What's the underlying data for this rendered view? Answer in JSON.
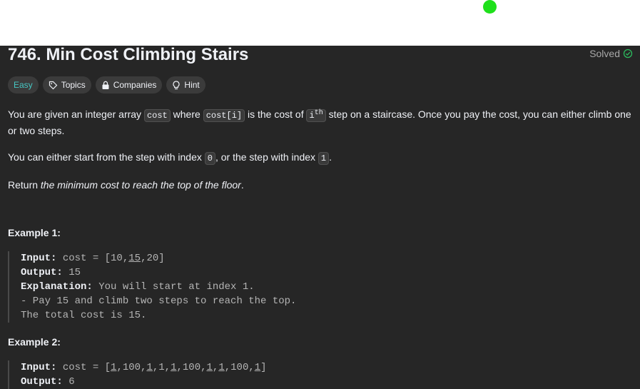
{
  "problem": {
    "title": "746. Min Cost Climbing Stairs",
    "solved_label": "Solved"
  },
  "tags": {
    "difficulty": "Easy",
    "topics": "Topics",
    "companies": "Companies",
    "hint": "Hint"
  },
  "description": {
    "p1_a": "You are given an integer array ",
    "p1_code1": "cost",
    "p1_b": " where ",
    "p1_code2": "cost[i]",
    "p1_c": " is the cost of ",
    "p1_code3": "i",
    "p1_sup": "th",
    "p1_d": " step on a staircase. Once you pay the cost, you can either climb one or two steps.",
    "p2_a": "You can either start from the step with index ",
    "p2_code1": "0",
    "p2_b": ", or the step with index ",
    "p2_code2": "1",
    "p2_c": ".",
    "p3_a": "Return ",
    "p3_em": "the minimum cost to reach the top of the floor",
    "p3_b": "."
  },
  "example1": {
    "heading": "Example 1:",
    "input_label": "Input:",
    "input_pre": " cost = [10,",
    "input_u": "15",
    "input_post": ",20]",
    "output_label": "Output:",
    "output_value": " 15",
    "explanation_label": "Explanation:",
    "explanation_value": " You will start at index 1.",
    "line4": "- Pay 15 and climb two steps to reach the top.",
    "line5": "The total cost is 15."
  },
  "example2": {
    "heading": "Example 2:",
    "input_label": "Input:",
    "input_parts": [
      " cost = [",
      "1",
      ",100,",
      "1",
      ",1,",
      "1",
      ",100,",
      "1",
      ",",
      "1",
      ",100,",
      "1",
      "]"
    ],
    "output_label": "Output:",
    "output_value": " 6"
  },
  "colors": {
    "accent_easy": "#46c6c2",
    "solved_green": "#2cbb5d",
    "panel_bg": "#262626",
    "dot_green": "#1fe01b"
  },
  "icons": [
    "solved-check-icon",
    "tag-icon",
    "lock-icon",
    "lightbulb-icon"
  ]
}
